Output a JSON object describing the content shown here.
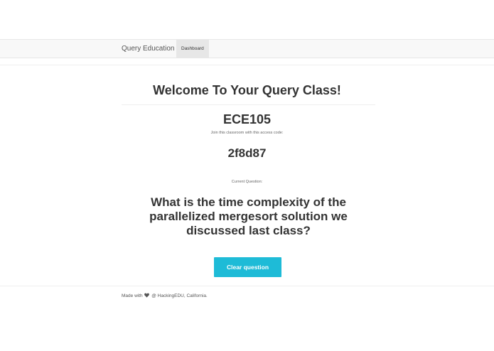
{
  "navbar": {
    "brand": "Query Education",
    "active_item": "Dashboard"
  },
  "main": {
    "title": "Welcome To Your Query Class!",
    "class_name": "ECE105",
    "join_label": "Join this classroom with this access code:",
    "access_code": "2f8d87",
    "current_question_label": "Current Question:",
    "question": "What is the time complexity of the parallelized mergesort solution we discussed last class?",
    "clear_button": "Clear question"
  },
  "footer": {
    "made_with": "Made with",
    "heart_icon": "heart-icon",
    "suffix": "@ HackingEDU, California."
  },
  "colors": {
    "accent": "#1ebbd7",
    "navbar_bg": "#f8f8f8",
    "text": "#333333"
  }
}
